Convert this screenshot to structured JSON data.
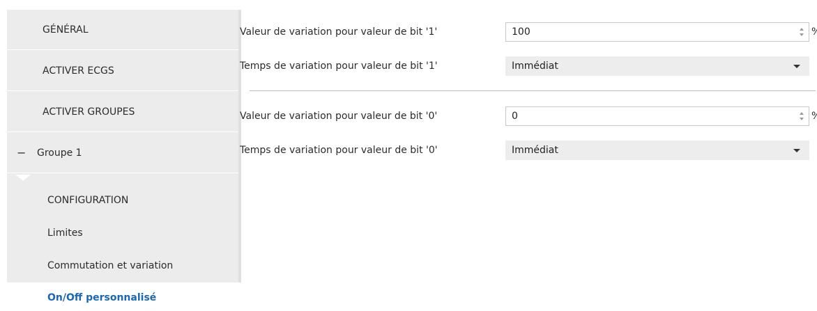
{
  "sidebar": {
    "items": [
      {
        "label": "GÉNÉRAL"
      },
      {
        "label": "ACTIVER ECGS"
      },
      {
        "label": "ACTIVER GROUPES"
      }
    ],
    "group": {
      "label": "Groupe 1",
      "collapse_glyph": "−",
      "icon": "collapse-icon"
    },
    "sub_items": [
      {
        "label": "CONFIGURATION"
      },
      {
        "label": "Limites"
      },
      {
        "label": "Commutation et variation"
      },
      {
        "label": "On/Off personnalisé",
        "active": true
      }
    ],
    "active_color": "#1a67b5"
  },
  "main": {
    "bit1": {
      "value_label": "Valeur de variation pour valeur de bit '1'",
      "value": "100",
      "unit": "%",
      "time_label": "Temps de variation pour valeur de bit '1'",
      "time_value": "Immédiat"
    },
    "bit0": {
      "value_label": "Valeur de variation pour valeur de bit '0'",
      "value": "0",
      "unit": "%",
      "time_label": "Temps de variation pour valeur de bit '0'",
      "time_value": "Immédiat"
    }
  }
}
